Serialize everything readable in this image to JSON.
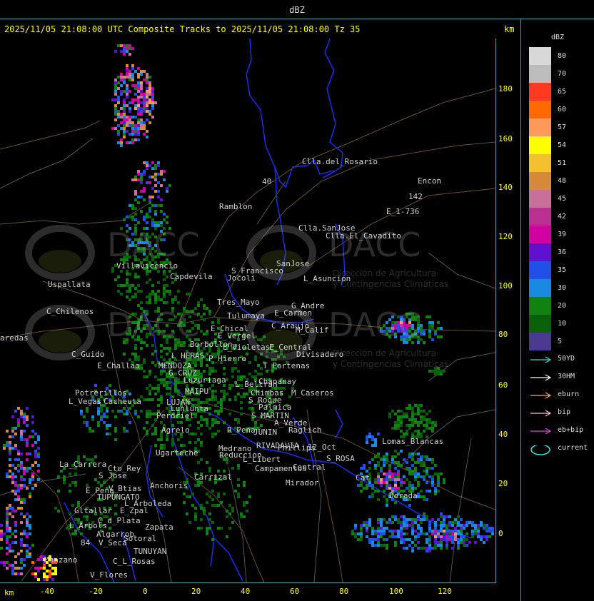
{
  "window_title": "dBZ",
  "header": {
    "text": "2025/11/05 21:08:00 UTC Composite Tracks to 2025/11/05 21:08:00 Tz 35",
    "unit_right": "km"
  },
  "axes": {
    "y_ticks": [
      "180",
      "160",
      "140",
      "120",
      "100",
      "80",
      "60",
      "40",
      "20",
      "0"
    ],
    "x_ticks": [
      "-40",
      "-20",
      "0",
      "20",
      "40",
      "60",
      "80",
      "100",
      "120"
    ],
    "x_unit": "km"
  },
  "legend": {
    "title": "dBZ",
    "levels": [
      {
        "label": "80",
        "color": "#d8d8d8"
      },
      {
        "label": "70",
        "color": "#bcbcbc"
      },
      {
        "label": "65",
        "color": "#ff3a1e"
      },
      {
        "label": "60",
        "color": "#ff6a00"
      },
      {
        "label": "57",
        "color": "#ff9a5a"
      },
      {
        "label": "54",
        "color": "#ffff00"
      },
      {
        "label": "51",
        "color": "#f5c030"
      },
      {
        "label": "48",
        "color": "#d88a3c"
      },
      {
        "label": "45",
        "color": "#c8709a"
      },
      {
        "label": "42",
        "color": "#b83090"
      },
      {
        "label": "39",
        "color": "#d000a0"
      },
      {
        "label": "36",
        "color": "#6010d0"
      },
      {
        "label": "35",
        "color": "#2050e8"
      },
      {
        "label": "30",
        "color": "#1a8ae0"
      },
      {
        "label": "20",
        "color": "#108010"
      },
      {
        "label": "10",
        "color": "#0a600a"
      },
      {
        "label": "5",
        "color": "#4a3a90"
      }
    ]
  },
  "tracks": [
    {
      "label": "50YD",
      "color": "#40d0d0"
    },
    {
      "label": "30HM",
      "color": "#ffffff"
    },
    {
      "label": "eburn",
      "color": "#f0b060"
    },
    {
      "label": "bip",
      "color": "#ffc0c0"
    },
    {
      "label": "eb+bip",
      "color": "#e040e0"
    },
    {
      "label": "current",
      "color": "#40e0e0"
    }
  ],
  "watermark": {
    "brand": "DACC",
    "line1": "Dirección de Agricultura",
    "line2": "y Contingencias Climáticas"
  },
  "places": [
    {
      "name": "Clla.del_Rosario"
    },
    {
      "name": "Encon"
    },
    {
      "name": "142"
    },
    {
      "name": "E_1-736"
    },
    {
      "name": "Ramblon"
    },
    {
      "name": "Clla.SanJose"
    },
    {
      "name": "Clla.El_Cavadito"
    },
    {
      "name": "Villavicencio"
    },
    {
      "name": "Uspallata"
    },
    {
      "name": "Capdevila"
    },
    {
      "name": "S_Francisco"
    },
    {
      "name": "Jocoli"
    },
    {
      "name": "SanJose"
    },
    {
      "name": "L_Asuncion"
    },
    {
      "name": "Tres_Mayo"
    },
    {
      "name": "C_Chilenos"
    },
    {
      "name": "Tulumaya"
    },
    {
      "name": "G_Andre"
    },
    {
      "name": "E_Carmen"
    },
    {
      "name": "E_Chical"
    },
    {
      "name": "E_Vergel"
    },
    {
      "name": "C_Araujo"
    },
    {
      "name": "M_Calif"
    },
    {
      "name": "aredas"
    },
    {
      "name": "Borbollon"
    },
    {
      "name": "L_Violetas"
    },
    {
      "name": "E_Central"
    },
    {
      "name": "Divisadero"
    },
    {
      "name": "C_Guido"
    },
    {
      "name": "L_HERAS"
    },
    {
      "name": "P_Hierro"
    },
    {
      "name": "E_Challao"
    },
    {
      "name": "MENDOZA"
    },
    {
      "name": "T_Portenas"
    },
    {
      "name": "G_CRUZ"
    },
    {
      "name": "Luzuriaga"
    },
    {
      "name": "Chapanay"
    },
    {
      "name": "L_Beltran"
    },
    {
      "name": "Potrerillos"
    },
    {
      "name": "MAIPU"
    },
    {
      "name": "Chimbas"
    },
    {
      "name": "M_Caseros"
    },
    {
      "name": "L_Vegas"
    },
    {
      "name": "Cacheuta"
    },
    {
      "name": "LUJAN"
    },
    {
      "name": "S_Roque"
    },
    {
      "name": "Lunlunta"
    },
    {
      "name": "Palmica"
    },
    {
      "name": "Perdriel"
    },
    {
      "name": "S_MARTIN"
    },
    {
      "name": "A_Verde"
    },
    {
      "name": "Agrelo"
    },
    {
      "name": "R_Pena"
    },
    {
      "name": "JUNIN"
    },
    {
      "name": "Raglich"
    },
    {
      "name": "Ugarteche"
    },
    {
      "name": "Medrano"
    },
    {
      "name": "RIVADAVIA"
    },
    {
      "name": "Phillips"
    },
    {
      "name": "12_Oct"
    },
    {
      "name": "Reduccion"
    },
    {
      "name": "L_Libert"
    },
    {
      "name": "S_ROSA"
    },
    {
      "name": "Lomas_Blancas"
    },
    {
      "name": "La_Carrera"
    },
    {
      "name": "Cto_Rey"
    },
    {
      "name": "Carrizal"
    },
    {
      "name": "Campamentos"
    },
    {
      "name": "Central"
    },
    {
      "name": "S_Jose"
    },
    {
      "name": "Cat"
    },
    {
      "name": "Anchoris"
    },
    {
      "name": "Mirador"
    },
    {
      "name": "V_Btias"
    },
    {
      "name": "E_Pena"
    },
    {
      "name": "TUPUNGATO"
    },
    {
      "name": "Dorada"
    },
    {
      "name": "L_Arboleda"
    },
    {
      "name": "Gltallar"
    },
    {
      "name": "E_Zpal"
    },
    {
      "name": "L_Arbols"
    },
    {
      "name": "C_d_Plata"
    },
    {
      "name": "Zapata"
    },
    {
      "name": "Algarrob"
    },
    {
      "name": "V_Seca"
    },
    {
      "name": "Sotoral"
    },
    {
      "name": "Manzano"
    },
    {
      "name": "TUNUYAN"
    },
    {
      "name": "C_L_Rosas"
    },
    {
      "name": "V_Flores"
    },
    {
      "name": "84"
    },
    {
      "name": "40"
    }
  ]
}
